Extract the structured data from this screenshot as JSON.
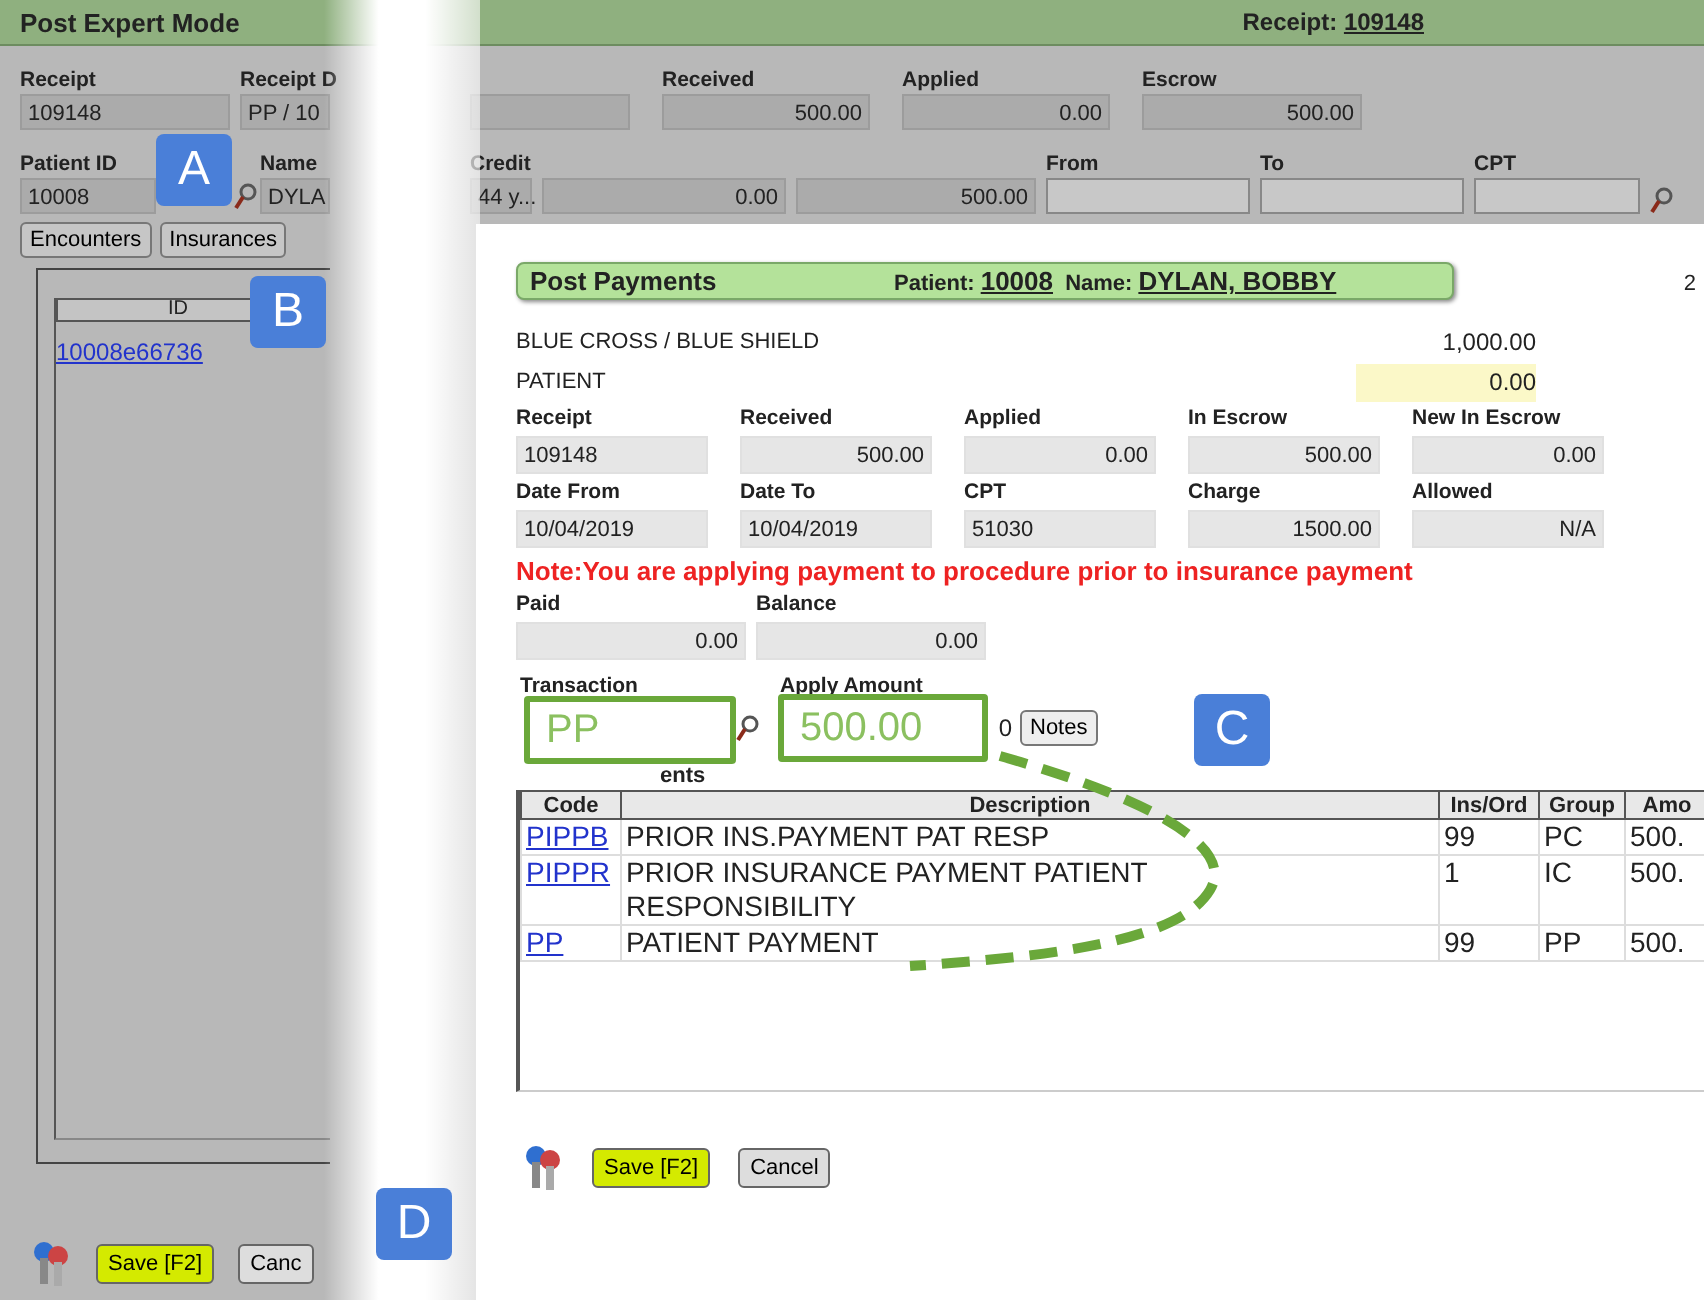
{
  "main_window": {
    "title": "Post Expert Mode",
    "receipt_label": "Receipt:",
    "receipt_number": "109148",
    "row1": [
      {
        "label": "Receipt",
        "value": "109148"
      },
      {
        "label": "Receipt D",
        "value": "PP / 10"
      }
    ],
    "row1_right": [
      {
        "label": "Received",
        "value": "500.00"
      },
      {
        "label": "Applied",
        "value": "0.00"
      },
      {
        "label": "Escrow",
        "value": "500.00"
      }
    ],
    "row2": [
      {
        "label": "Patient ID",
        "value": "10008"
      },
      {
        "label": "Name",
        "value": "DYLA"
      }
    ],
    "row2_right": [
      {
        "label": "Credit",
        "value": "44 y..."
      },
      {
        "value": "0.00"
      },
      {
        "value": "500.00"
      },
      {
        "label": "From"
      },
      {
        "label": "To"
      },
      {
        "label": "CPT"
      }
    ],
    "tabs": [
      {
        "label": "Encounters",
        "selected": false
      },
      {
        "label": "Insurances",
        "selected": false
      }
    ],
    "list": {
      "columns": [
        "ID"
      ],
      "rows": [
        {
          "id": "10008e66736"
        }
      ]
    },
    "buttons": [
      {
        "label": "Save [F2]",
        "kind": "primary"
      },
      {
        "label": "Canc",
        "kind": "normal"
      }
    ]
  },
  "dialog": {
    "title": "Post Payments",
    "patient_label": "Patient:",
    "patient_id": "10008",
    "name_label": "Name:",
    "patient_name": "DYLAN, BOBBY",
    "edge_text": "2",
    "payers": [
      {
        "name": "BLUE CROSS / BLUE SHIELD",
        "amount": "1,000.00",
        "highlighted": false
      },
      {
        "name": "PATIENT",
        "amount": "0.00",
        "highlighted": true
      }
    ],
    "fields": [
      {
        "label": "Receipt",
        "value": "109148"
      },
      {
        "label": "Received",
        "value": "500.00"
      },
      {
        "label": "Applied",
        "value": "0.00"
      },
      {
        "label": "In Escrow",
        "value": "500.00"
      },
      {
        "label": "New In Escrow",
        "value": "0.00"
      },
      {
        "label": "Date From",
        "value": "10/04/2019"
      },
      {
        "label": "Date To",
        "value": "10/04/2019"
      },
      {
        "label": "CPT",
        "value": "51030"
      },
      {
        "label": "Charge",
        "value": "1500.00"
      },
      {
        "label": "Allowed",
        "value": "N/A"
      }
    ],
    "note": "Note:You are applying payment to procedure prior to insurance payment",
    "paid": {
      "label": "Paid",
      "value": "0.00"
    },
    "balance": {
      "label": "Balance",
      "value": "0.00"
    },
    "transaction_label": "Transaction",
    "apply_label": "Apply Amount",
    "apply_tail": "0",
    "notes_button": "Notes",
    "list_caption": "ents",
    "table": {
      "columns": [
        "Code",
        "Description",
        "Ins/Ord",
        "Group",
        "Amo"
      ],
      "rows": [
        {
          "code": "PIPPB",
          "description": "PRIOR INS.PAYMENT PAT RESP",
          "ins_ord": "99",
          "group": "PC",
          "amount": "500."
        },
        {
          "code": "PIPPR",
          "description": "PRIOR INSURANCE PAYMENT PATIENT RESPONSIBILITY",
          "ins_ord": "1",
          "group": "IC",
          "amount": "500."
        },
        {
          "code": "PP",
          "description": "PATIENT PAYMENT",
          "ins_ord": "99",
          "group": "PP",
          "amount": "500."
        }
      ]
    },
    "buttons": [
      {
        "label": "Save [F2]",
        "kind": "primary"
      },
      {
        "label": "Cancel",
        "kind": "normal"
      }
    ]
  },
  "zoom_boxes": [
    {
      "value": "PP"
    },
    {
      "value": "500.00"
    }
  ],
  "callouts": [
    "A",
    "B",
    "C",
    "D"
  ]
}
